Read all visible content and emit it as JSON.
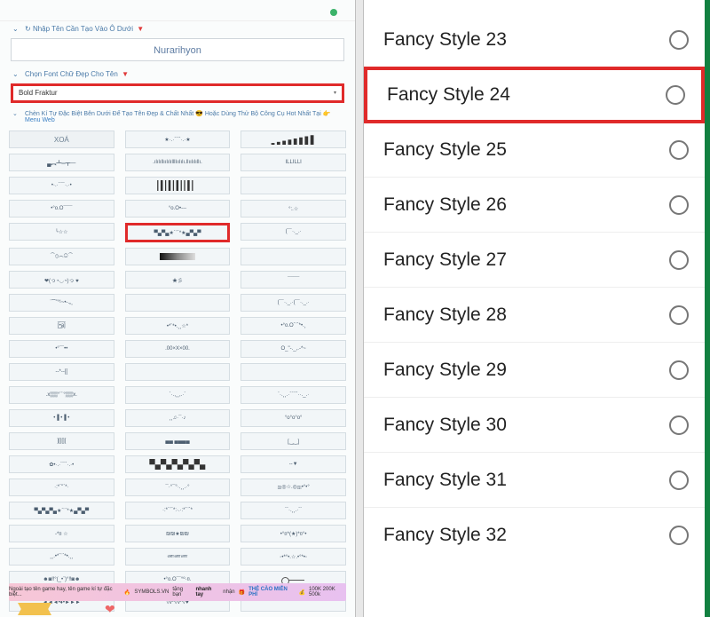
{
  "left": {
    "section1": "Nhập Tên Cần Tạo Vào Ô Dưới",
    "name": "Nurarihyon",
    "section2": "Chọn Font Chữ Đẹp Cho Tên",
    "font": "Bold Fraktur",
    "section3_pre": "Chèn Kí Tự Đặc Biệt Bên Dưới Để Tạo Tên Đẹp & Chất Nhất",
    "section3_mid": "Hoặc Dùng Thử Bộ Công Cụ Hot Nhất Tại",
    "section3_link": "Menu Web",
    "clear": "XOÁ",
    "cells": {
      "r1c2": "★·.·´¯`·.·★",
      "r1c3_alt": "signal-bars",
      "r2c1": "▄︻┻═┳一",
      "r2c2": ".ılılıllıılılıllllıılılı.llıılılıllı.",
      "r2c3": "ILLILLI",
      "r3c1": "•·.·´¯`·.·•",
      "r3c2_alt": "barcode",
      "r3c3": "",
      "r4c1": "•°o.O¯¯¯",
      "r4c2": "°o.O•---",
      "r4c3": "°:.☆",
      "r5c1": "╰☆☆",
      "r5c2": "▀▄▀▄★´¨`*★▄▀▄▀",
      "r5c3": "(¯`·._.·",
      "r6c1": "⁀⊙෴☉⁀",
      "r6c2_alt": "gradient",
      "r6c3": "",
      "r7c1": "❤(っ◔◡◔)っ ♥",
      "r7c2": "★彡",
      "r7c3": "¯¯¯¯",
      "r8c1": "¨˜ˆ”°¹~•-.„¸",
      "r8c2": "",
      "r8c3": "(¯`·._.·(¯`·._.·",
      "r9c1": "[̲̅•̲̅a̲̅]",
      "r9c2": "•*¨*•.¸¸☆*",
      "r9c3": "•°o.O´¨`*•.¸",
      "r10c1": "•°¯`••",
      "r10c2": ".00×X×00.",
      "r10c3": "O_\"-._,.-*~",
      "r11c1": "--*--[[",
      "r11c2": "",
      "r11c3": "",
      "r12c1": ".x▒▒°¨¨°▒▒x.",
      "r12c2": "`·.,¸¸,.·´",
      "r12c3": "`·.¸¸.·´´¯`··._.·",
      "r13c1": "•▐ •▐ •",
      "r13c2": "¸¸♫·¯·♪",
      "r13c3": "°o°o°o°",
      "r14c1": "][][][",
      "r14c2": "▄▄ ▄▄▄▄",
      "r14c3": "[‿̲‿]",
      "r15c1": "✿•·.·´¯`·.·•",
      "r15c2_alt": "checker",
      "r15c3": "--▼",
      "r16c1": "·:*´\"`*·",
      "r16c2": "¯·°¯°·.¸¸.·°",
      "r16c3": "ஐ◎☆.◎ஐ•°•°",
      "r17c1": "▀▄▀▄▀▄★´¨`*★▄▀▄▀",
      "r17c2": "·:*´¨`*:·.·:*´¨`*",
      "r17c3": "``·.¸¸.·´´",
      "r18c1": "-*¤ ☆",
      "r18c2": "₪₪★₪₪",
      "r18c3": "•°¤*(★)*¤°•",
      "r19c1": "¸¸.•*´¨`*•.¸¸",
      "r19c2": "ணணண",
      "r19c3": "◦•*°•.☆.•°*•◦",
      "r20c1": "☻◙‼°(_•¨)°‼◙☻",
      "r20c2": "•°o.O¯`°º·¤.",
      "r20c3_alt": "key",
      "r21c1": "◄◄◄•♦•►►►",
      "r21c2": "√v^√v^√♥",
      "r21c3": ""
    },
    "footer_pre": "Ngoài tạo tên game hay, tên game kí tự đặc biệt...",
    "footer_brand": "SYMBOLS.VN",
    "footer_mid": "tặng bạn",
    "footer_bold": "nhanh tay",
    "footer_post": "nhận",
    "footer_card": "THẺ CÀO MIỄN PHÍ",
    "footer_amount": "100K 200K 500k"
  },
  "right": {
    "items": [
      {
        "label": "Fancy Style 23",
        "hi": false
      },
      {
        "label": "Fancy Style 24",
        "hi": true
      },
      {
        "label": "Fancy Style 25",
        "hi": false
      },
      {
        "label": "Fancy Style 26",
        "hi": false
      },
      {
        "label": "Fancy Style 27",
        "hi": false
      },
      {
        "label": "Fancy Style 28",
        "hi": false
      },
      {
        "label": "Fancy Style 29",
        "hi": false
      },
      {
        "label": "Fancy Style 30",
        "hi": false
      },
      {
        "label": "Fancy Style 31",
        "hi": false
      },
      {
        "label": "Fancy Style 32",
        "hi": false
      }
    ]
  }
}
